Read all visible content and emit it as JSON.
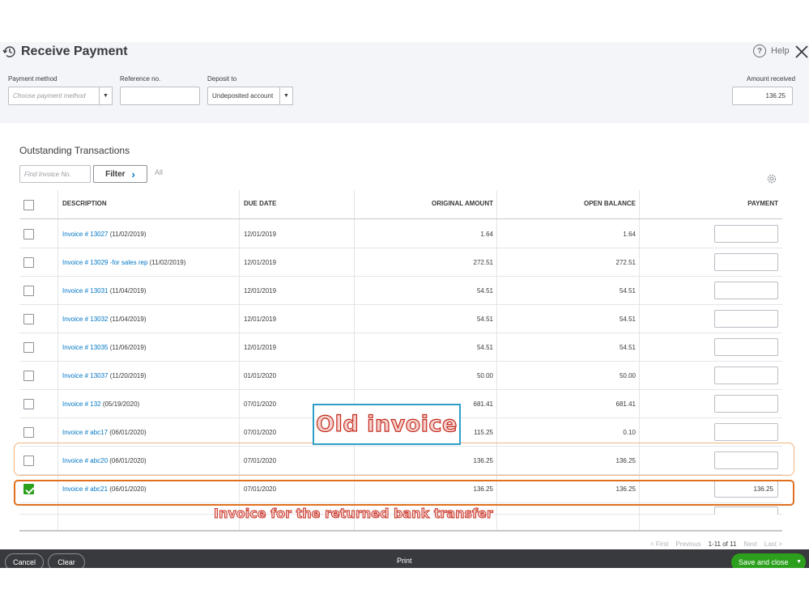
{
  "header": {
    "title": "Receive Payment",
    "help_label": "Help",
    "help_symbol": "?"
  },
  "form": {
    "payment_method": {
      "label": "Payment method",
      "placeholder": "Choose payment method"
    },
    "reference_no": {
      "label": "Reference no.",
      "value": ""
    },
    "deposit_to": {
      "label": "Deposit to",
      "value": "Undeposited account"
    },
    "amount_received": {
      "label": "Amount received",
      "value": "136.25"
    },
    "dropdown_glyph": "▼"
  },
  "transactions": {
    "title": "Outstanding Transactions",
    "find_placeholder": "Find Invoice No.",
    "filter_label": "Filter",
    "filter_chevron": "›",
    "all_label": "All",
    "columns": {
      "description": "DESCRIPTION",
      "due_date": "DUE DATE",
      "original_amount": "ORIGINAL AMOUNT",
      "open_balance": "OPEN BALANCE",
      "payment": "PAYMENT"
    },
    "rows": [
      {
        "link": "Invoice # 13027",
        "date_note": " (11/02/2019)",
        "due": "12/01/2019",
        "original": "1.64",
        "open": "1.64",
        "payment": "",
        "checked": false
      },
      {
        "link": "Invoice # 13029 -for sales rep",
        "date_note": " (11/02/2019)",
        "due": "12/01/2019",
        "original": "272.51",
        "open": "272.51",
        "payment": "",
        "checked": false
      },
      {
        "link": "Invoice # 13031",
        "date_note": " (11/04/2019)",
        "due": "12/01/2019",
        "original": "54.51",
        "open": "54.51",
        "payment": "",
        "checked": false
      },
      {
        "link": "Invoice # 13032",
        "date_note": " (11/04/2019)",
        "due": "12/01/2019",
        "original": "54.51",
        "open": "54.51",
        "payment": "",
        "checked": false
      },
      {
        "link": "Invoice # 13035",
        "date_note": " (11/06/2019)",
        "due": "12/01/2019",
        "original": "54.51",
        "open": "54.51",
        "payment": "",
        "checked": false
      },
      {
        "link": "Invoice # 13037",
        "date_note": " (11/20/2019)",
        "due": "01/01/2020",
        "original": "50.00",
        "open": "50.00",
        "payment": "",
        "checked": false
      },
      {
        "link": "Invoice # 132",
        "date_note": " (05/19/2020)",
        "due": "07/01/2020",
        "original": "681.41",
        "open": "681.41",
        "payment": "",
        "checked": false
      },
      {
        "link": "Invoice # abc17",
        "date_note": " (06/01/2020)",
        "due": "07/01/2020",
        "original": "115.25",
        "open": "0.10",
        "payment": "",
        "checked": false
      },
      {
        "link": "Invoice # abc20",
        "date_note": " (06/01/2020)",
        "due": "07/01/2020",
        "original": "136.25",
        "open": "136.25",
        "payment": "",
        "checked": false
      },
      {
        "link": "Invoice # abc21",
        "date_note": " (06/01/2020)",
        "due": "07/01/2020",
        "original": "136.25",
        "open": "136.25",
        "payment": "136.25",
        "checked": true
      }
    ]
  },
  "pagination": {
    "first": "< First",
    "previous": "Previous",
    "range": "1-11 of 11",
    "next": "Next",
    "last": "Last >"
  },
  "footer": {
    "cancel": "Cancel",
    "clear": "Clear",
    "print": "Print",
    "save_and_close": "Save and close",
    "save_caret": "▼"
  },
  "annotations": {
    "old_invoice": "Old invoice",
    "returned_transfer": "Invoice for the returned bank transfer"
  },
  "colors": {
    "link": "#0077c5",
    "primary_green": "#2ca01c",
    "footer_bg": "#393a3d",
    "annotation_red": "#c42a1e",
    "annotation_orange": "#e0701f",
    "annotation_blue": "#2e9fc6"
  }
}
